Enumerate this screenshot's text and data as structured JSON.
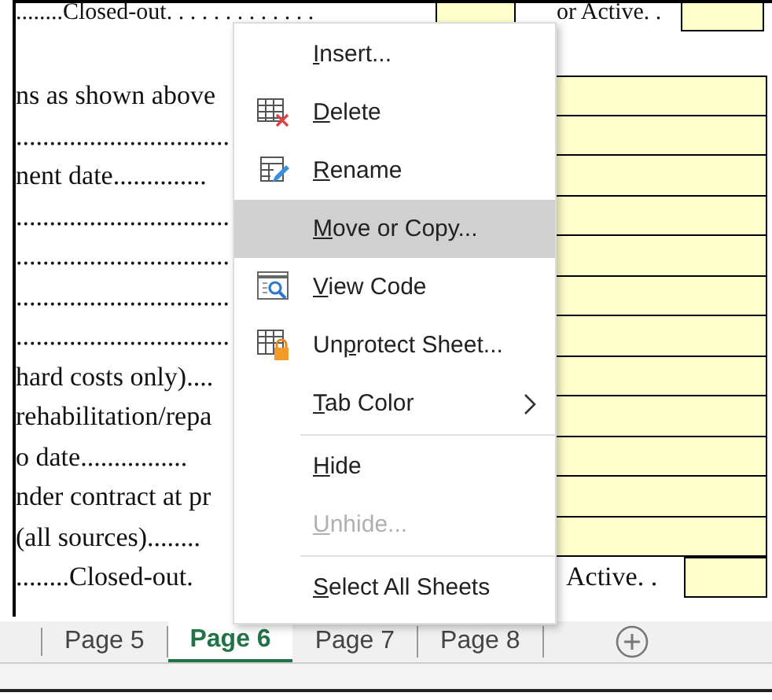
{
  "sheet": {
    "rows": [
      {
        "kind": "split",
        "text": "........Closed-out. . . . . . . . . . . . .",
        "right_text": "or Active. ."
      },
      {
        "kind": "field",
        "text": "ns as shown above"
      },
      {
        "kind": "field",
        "text": "................................"
      },
      {
        "kind": "field",
        "text": "nent date.............."
      },
      {
        "kind": "field",
        "text": "................................"
      },
      {
        "kind": "field",
        "text": "................................"
      },
      {
        "kind": "field",
        "text": "................................"
      },
      {
        "kind": "field",
        "text": "................................"
      },
      {
        "kind": "field",
        "text": "hard costs only)...."
      },
      {
        "kind": "field",
        "text": "rehabilitation/repa"
      },
      {
        "kind": "field",
        "text": "o date................"
      },
      {
        "kind": "field",
        "text": "nder contract at pr"
      },
      {
        "kind": "field",
        "text": "(all sources)........"
      },
      {
        "kind": "split",
        "text": "........Closed-out.",
        "right_text": "Active. ."
      }
    ]
  },
  "menu": {
    "items": [
      {
        "kind": "command",
        "key": "I",
        "post": "nsert...",
        "selected": false,
        "disabled": false
      },
      {
        "kind": "command",
        "key": "D",
        "post": "elete",
        "selected": false,
        "disabled": false
      },
      {
        "kind": "command",
        "key": "R",
        "post": "ename",
        "selected": false,
        "disabled": false
      },
      {
        "kind": "command",
        "key": "M",
        "post": "ove or Copy...",
        "selected": true,
        "disabled": false
      },
      {
        "kind": "command",
        "key": "V",
        "post": "iew Code",
        "selected": false,
        "disabled": false
      },
      {
        "kind": "command",
        "pre": "Un",
        "key": "p",
        "post": "rotect Sheet...",
        "selected": false,
        "disabled": false
      },
      {
        "kind": "submenu",
        "key": "T",
        "post": "ab Color",
        "selected": false,
        "disabled": false
      },
      {
        "kind": "separator"
      },
      {
        "kind": "command",
        "key": "H",
        "post": "ide",
        "selected": false,
        "disabled": false
      },
      {
        "kind": "command",
        "key": "U",
        "post": "nhide...",
        "selected": false,
        "disabled": true
      },
      {
        "kind": "separator"
      },
      {
        "kind": "command",
        "key": "S",
        "post": "elect All Sheets",
        "selected": false,
        "disabled": false
      }
    ]
  },
  "tabs": [
    {
      "label": "Page 5",
      "selected": false
    },
    {
      "label": "Page 6",
      "selected": true
    },
    {
      "label": "Page 7",
      "selected": false
    },
    {
      "label": "Page 8",
      "selected": false
    }
  ]
}
